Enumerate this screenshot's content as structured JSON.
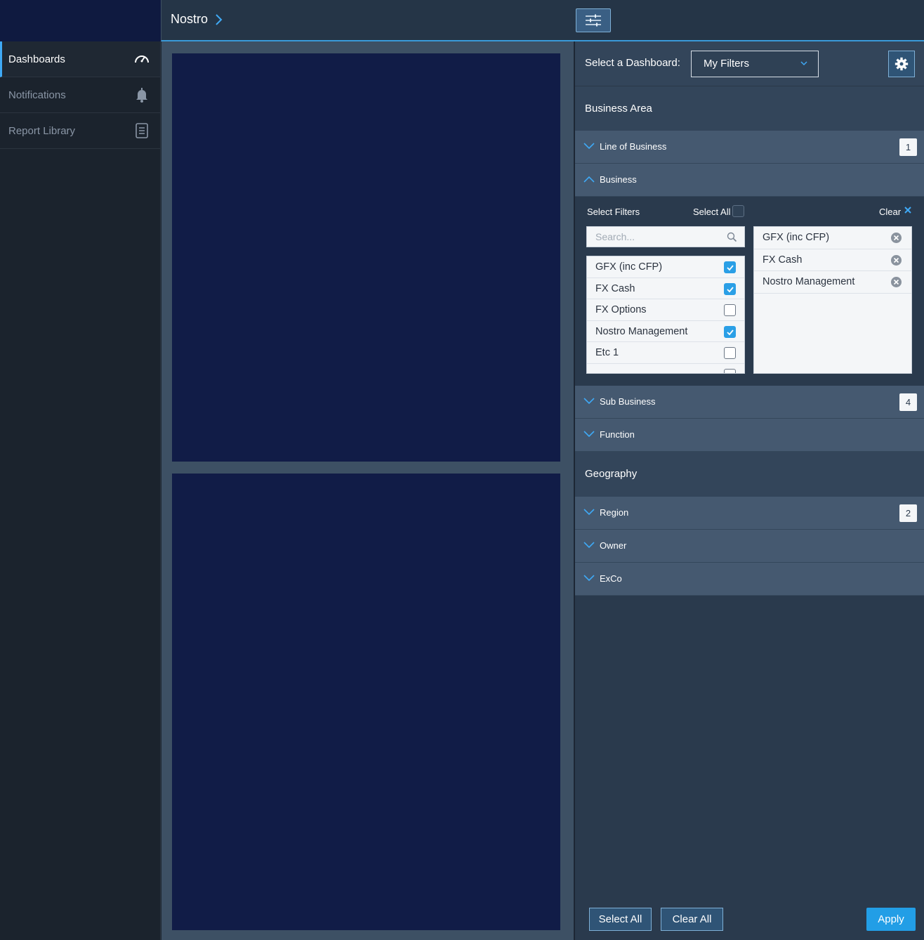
{
  "sidebar": {
    "items": [
      {
        "label": "Dashboards",
        "icon": "speedometer-icon",
        "active": true
      },
      {
        "label": "Notifications",
        "icon": "bell-icon",
        "active": false
      },
      {
        "label": "Report Library",
        "icon": "document-icon",
        "active": false
      }
    ]
  },
  "header": {
    "breadcrumb": "Nostro",
    "filter_toggle_icon": "sliders-icon"
  },
  "filter_panel": {
    "select_dashboard_label": "Select a Dashboard:",
    "dashboard_value": "My Filters",
    "settings_icon": "gear-icon",
    "business_area": {
      "title": "Business Area",
      "rows": [
        {
          "label": "Line of Business",
          "badge": "1",
          "expanded": false
        },
        {
          "label": "Business",
          "badge": "",
          "expanded": true
        },
        {
          "label": "Sub Business",
          "badge": "4",
          "expanded": false
        },
        {
          "label": "Function",
          "badge": "",
          "expanded": false
        }
      ]
    },
    "business": {
      "select_filters_label": "Select Filters",
      "select_all_label": "Select All",
      "clear_label": "Clear",
      "search_placeholder": "Search...",
      "options": [
        {
          "label": "GFX (inc CFP)",
          "checked": true
        },
        {
          "label": "FX Cash",
          "checked": true
        },
        {
          "label": "FX Options",
          "checked": false
        },
        {
          "label": "Nostro Management",
          "checked": true
        },
        {
          "label": "Etc 1",
          "checked": false
        }
      ],
      "selected": [
        "GFX (inc CFP)",
        "FX Cash",
        "Nostro Management"
      ]
    },
    "geography": {
      "title": "Geography",
      "rows": [
        {
          "label": "Region",
          "badge": "2"
        },
        {
          "label": "Owner",
          "badge": ""
        },
        {
          "label": "ExCo",
          "badge": ""
        }
      ]
    },
    "buttons": {
      "select_all": "Select All",
      "clear_all": "Clear All",
      "apply": "Apply"
    }
  },
  "colors": {
    "accent": "#3fa9f5",
    "apply": "#229ee6",
    "panel_navy": "#111c47"
  }
}
